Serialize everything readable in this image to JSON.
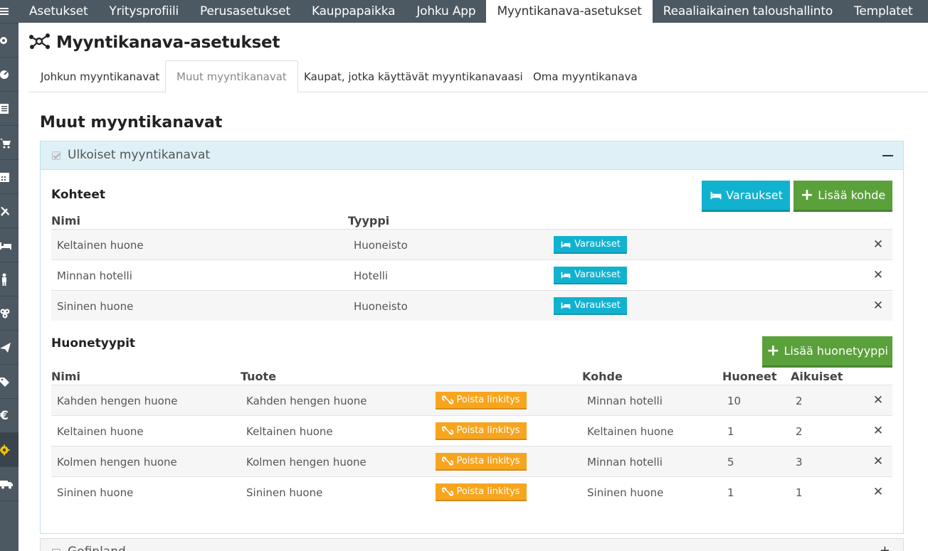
{
  "top_tabs": [
    {
      "label": "Asetukset"
    },
    {
      "label": "Yritysprofiili"
    },
    {
      "label": "Perusasetukset"
    },
    {
      "label": "Kauppapaikka"
    },
    {
      "label": "Johku App"
    },
    {
      "label": "Myyntikanava-asetukset",
      "active": true
    },
    {
      "label": "Reaaliaikainen taloushallinto"
    },
    {
      "label": "Templatet"
    }
  ],
  "sidebar_icons": [
    "menu-icon",
    "settings-icon",
    "dashboard-icon",
    "document-icon",
    "cart-icon",
    "calendar-icon",
    "tools-icon",
    "bed-icon",
    "person-icon",
    "group-icon",
    "send-icon",
    "tag-icon",
    "euro-icon",
    "gear-icon",
    "truck-icon"
  ],
  "page": {
    "title": "Myyntikanava-asetukset",
    "title_icon": "network-icon"
  },
  "sub_tabs": [
    {
      "label": "Johkun myyntikanavat"
    },
    {
      "label": "Muut myyntikanavat",
      "active": true
    },
    {
      "label": "Kaupat, jotka käyttävät myyntikanavaasi"
    },
    {
      "label": "Oma myyntikanava"
    }
  ],
  "section": {
    "title": "Muut myyntikanavat"
  },
  "panel": {
    "label": "Ulkoiset myyntikanavat",
    "checked": true,
    "collapse_icon": "minus-icon"
  },
  "kohteet": {
    "title": "Kohteet",
    "varaukset_button": "Varaukset",
    "add_button": "Lisää kohde",
    "col_name": "Nimi",
    "col_type": "Tyyppi",
    "row_button": "Varaukset",
    "rows": [
      {
        "name": "Keltainen huone",
        "type": "Huoneisto"
      },
      {
        "name": "Minnan hotelli",
        "type": "Hotelli"
      },
      {
        "name": "Sininen huone",
        "type": "Huoneisto"
      }
    ]
  },
  "huonetyypit": {
    "title": "Huonetyypit",
    "add_button": "Lisää huonetyyppi",
    "col_name": "Nimi",
    "col_product": "Tuote",
    "col_target": "Kohde",
    "col_rooms": "Huoneet",
    "col_adults": "Aikuiset",
    "row_button": "Poista linkitys",
    "rows": [
      {
        "name": "Kahden hengen huone",
        "product": "Kahden hengen huone",
        "target": "Minnan hotelli",
        "rooms": "10",
        "adults": "2"
      },
      {
        "name": "Keltainen huone",
        "product": "Keltainen huone",
        "target": "Keltainen huone",
        "rooms": "1",
        "adults": "2"
      },
      {
        "name": "Kolmen hengen huone",
        "product": "Kolmen hengen huone",
        "target": "Minnan hotelli",
        "rooms": "5",
        "adults": "3"
      },
      {
        "name": "Sininen huone",
        "product": "Sininen huone",
        "target": "Sininen huone",
        "rooms": "1",
        "adults": "1"
      }
    ]
  },
  "delete_glyph": "✕",
  "panel2": {
    "label": "Gofipland",
    "expand_glyph": "+"
  },
  "colors": {
    "sidebar": "#4d5962",
    "cyan": "#11b2cf",
    "green": "#5aa13b",
    "orange": "#f8a51e",
    "panel_head": "#dff0f6",
    "active_icon": "#f4c400"
  }
}
